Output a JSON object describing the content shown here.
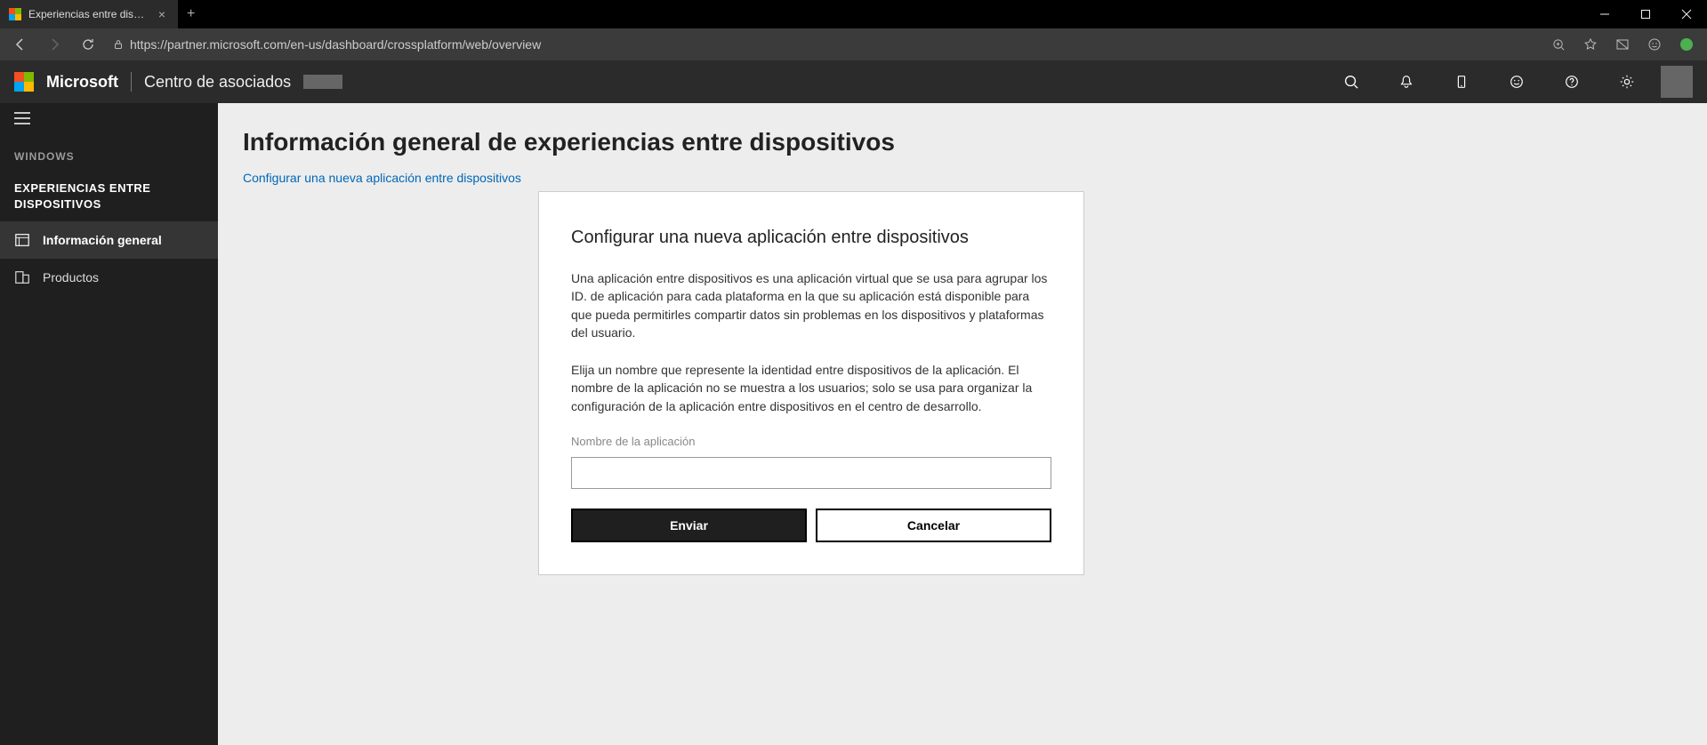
{
  "browser": {
    "tab_title": "Experiencias entre dispositivos",
    "url": "https://partner.microsoft.com/en-us/dashboard/crossplatform/web/overview"
  },
  "header": {
    "brand": "Microsoft",
    "product": "Centro de asociados",
    "icons": [
      "search",
      "bell",
      "device",
      "smile",
      "help",
      "settings"
    ]
  },
  "sidebar": {
    "group": "WINDOWS",
    "subgroup": "EXPERIENCIAS ENTRE DISPOSITIVOS",
    "items": [
      {
        "key": "overview",
        "label": "Información general",
        "active": true
      },
      {
        "key": "products",
        "label": "Productos",
        "active": false
      }
    ]
  },
  "page": {
    "title": "Información general de experiencias entre dispositivos",
    "config_link": "Configurar una nueva aplicación entre dispositivos"
  },
  "dialog": {
    "title": "Configurar una nueva aplicación entre dispositivos",
    "para1": "Una aplicación entre dispositivos es una aplicación virtual que se usa para agrupar los ID. de aplicación para cada plataforma en la que su aplicación está disponible para que pueda permitirles compartir datos sin problemas en los dispositivos y plataformas del usuario.",
    "para2": "Elija un nombre que represente la identidad entre dispositivos de la aplicación. El nombre de la aplicación no se muestra a los usuarios; solo se usa para organizar la configuración de la aplicación entre dispositivos en el centro de desarrollo.",
    "input_label": "Nombre de la aplicación",
    "input_value": "",
    "submit": "Enviar",
    "cancel": "Cancelar"
  }
}
